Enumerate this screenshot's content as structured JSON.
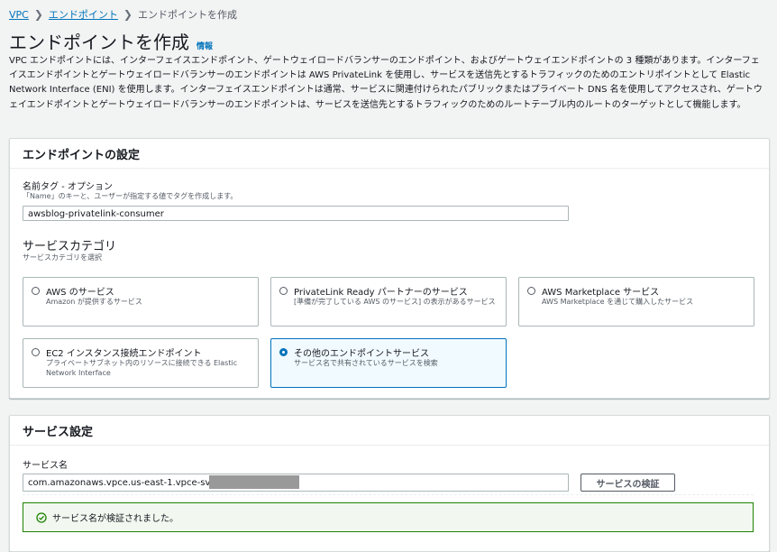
{
  "breadcrumb": {
    "vpc": "VPC",
    "endpoints": "エンドポイント",
    "current": "エンドポイントを作成",
    "separator": "❯"
  },
  "page": {
    "title": "エンドポイントを作成",
    "info": "情報",
    "description": "VPC エンドポイントには、インターフェイスエンドポイント、ゲートウェイロードバランサーのエンドポイント、およびゲートウェイエンドポイントの 3 種類があります。インターフェイスエンドポイントとゲートウェイロードバランサーのエンドポイントは AWS PrivateLink を使用し、サービスを送信先とするトラフィックのためのエントリポイントとして Elastic Network Interface (ENI) を使用します。インターフェイスエンドポイントは通常、サービスに関連付けられたパブリックまたはプライベート DNS 名を使用してアクセスされ、ゲートウェイエンドポイントとゲートウェイロードバランサーのエンドポイントは、サービスを送信先とするトラフィックのためのルートテーブル内のルートのターゲットとして機能します。"
  },
  "endpoint_settings": {
    "header": "エンドポイントの設定",
    "name_tag_label": "名前タグ - オプション",
    "name_tag_hint": "「Name」のキーと、ユーザーが指定する値でタグを作成します。",
    "name_tag_value": "awsblog-privatelink-consumer",
    "category_heading": "サービスカテゴリ",
    "category_hint": "サービスカテゴリを選択",
    "options": [
      {
        "title": "AWS のサービス",
        "subtitle": "Amazon が提供するサービス"
      },
      {
        "title": "PrivateLink Ready パートナーのサービス",
        "subtitle": "[準備が完了している AWS のサービス] の表示があるサービス"
      },
      {
        "title": "AWS Marketplace サービス",
        "subtitle": "AWS Marketplace を通じて購入したサービス"
      },
      {
        "title": "EC2 インスタンス接続エンドポイント",
        "subtitle": "プライベートサブネット内のリソースに接続できる Elastic Network Interface"
      },
      {
        "title": "その他のエンドポイントサービス",
        "subtitle": "サービス名で共有されているサービスを検索"
      }
    ],
    "selected_option": "その他のエンドポイントサービス"
  },
  "service_settings": {
    "header": "サービス設定",
    "service_name_label": "サービス名",
    "service_name_value": "com.amazonaws.vpce.us-east-1.vpce-svc-0",
    "verify_button": "サービスの検証",
    "success_message": "サービス名が検証されました。"
  },
  "colors": {
    "link": "#0073bb",
    "success": "#1d8102",
    "selected_bg": "#f1faff",
    "page_bg": "#f2f3f3"
  },
  "icons": {
    "separator": "chevron-right-icon",
    "success": "check-circle-icon"
  }
}
